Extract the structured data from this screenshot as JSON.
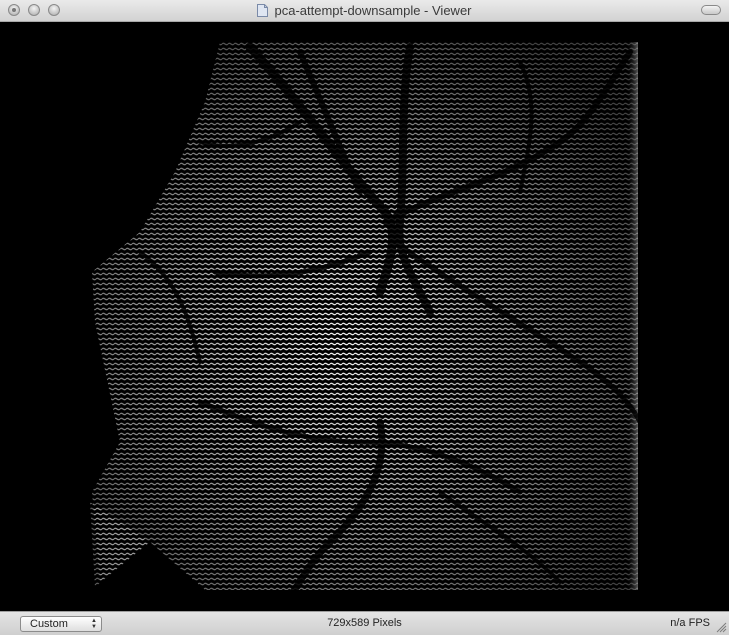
{
  "window": {
    "title": "pca-attempt-downsample - Viewer",
    "document_icon": "document-icon"
  },
  "viewer": {
    "image_description_icon": "image-canvas"
  },
  "status_bar": {
    "zoom_select": {
      "value": "Custom"
    },
    "dimensions": "729x589 Pixels",
    "fps": "n/a FPS"
  },
  "colors": {
    "viewport_background": "#000000",
    "chrome": "#e0e0e0"
  }
}
